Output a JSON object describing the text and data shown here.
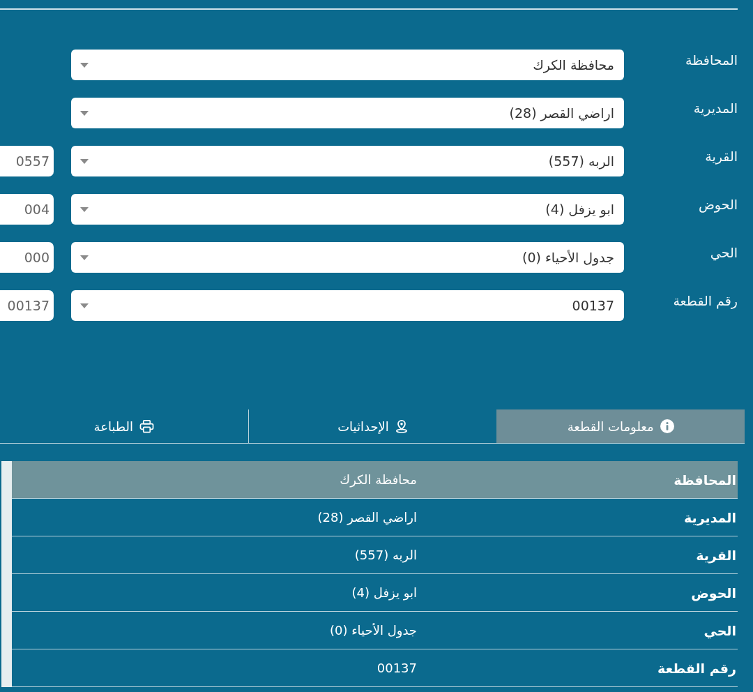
{
  "form": {
    "fields": [
      {
        "label": "المحافظة",
        "value": "محافظة الكرك"
      },
      {
        "label": "المديرية",
        "value": "اراضي القصر (28)"
      },
      {
        "label": "القرية",
        "value": "الربه (557)",
        "code": "0557"
      },
      {
        "label": "الحوض",
        "value": "ابو يزفل (4)",
        "code": "004"
      },
      {
        "label": "الحي",
        "value": "جدول الأحياء (0)",
        "code": "000"
      },
      {
        "label": "رقم القطعة",
        "value": "00137",
        "code": "00137"
      }
    ]
  },
  "tabs": [
    {
      "label": "معلومات القطعة",
      "selected": true
    },
    {
      "label": "الإحداثيات",
      "selected": false
    },
    {
      "label": "الطباعة",
      "selected": false
    }
  ],
  "table": {
    "rows": [
      {
        "label": "المحافظة",
        "value": "محافظة الكرك",
        "highlighted": true
      },
      {
        "label": "المديرية",
        "value": "اراضي القصر (28)",
        "highlighted": false
      },
      {
        "label": "القرية",
        "value": "الربه (557)",
        "highlighted": false
      },
      {
        "label": "الحوض",
        "value": "ابو يزفل (4)",
        "highlighted": false
      },
      {
        "label": "الحي",
        "value": "جدول الأحياء (0)",
        "highlighted": false
      },
      {
        "label": "رقم القطعة",
        "value": "00137",
        "highlighted": false
      }
    ]
  }
}
